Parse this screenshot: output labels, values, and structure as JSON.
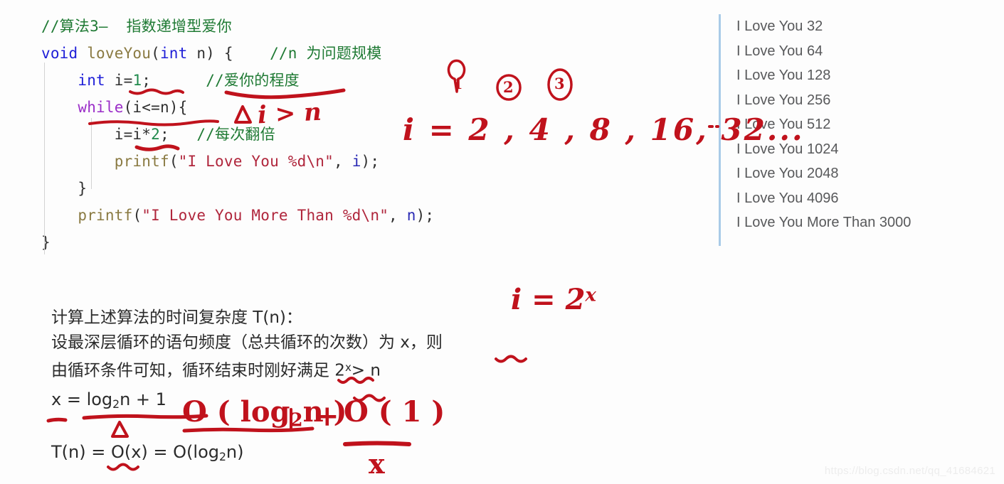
{
  "code": {
    "lines": [
      {
        "id": "comment-title",
        "tokens": [
          {
            "c": "cmt",
            "t": "//算法3—  指数递增型爱你"
          }
        ]
      },
      {
        "id": "func-signature",
        "tokens": [
          {
            "c": "kw",
            "t": "void"
          },
          {
            "c": "pl",
            "t": " "
          },
          {
            "c": "fn",
            "t": "loveYou"
          },
          {
            "c": "pl",
            "t": "("
          },
          {
            "c": "kw",
            "t": "int"
          },
          {
            "c": "pl",
            "t": " n) {"
          },
          {
            "c": "pl",
            "t": "    "
          },
          {
            "c": "cmt",
            "t": "//n 为问题规模"
          }
        ]
      },
      {
        "id": "decl-i",
        "tokens": [
          {
            "c": "pl",
            "t": "    "
          },
          {
            "c": "kw",
            "t": "int"
          },
          {
            "c": "pl",
            "t": " i="
          },
          {
            "c": "num",
            "t": "1"
          },
          {
            "c": "pl",
            "t": ";"
          },
          {
            "c": "pl",
            "t": "      "
          },
          {
            "c": "cmt",
            "t": "//爱你的程度"
          }
        ]
      },
      {
        "id": "while-head",
        "tokens": [
          {
            "c": "pl",
            "t": "    "
          },
          {
            "c": "kw2",
            "t": "while"
          },
          {
            "c": "pl",
            "t": "(i<=n){"
          }
        ]
      },
      {
        "id": "double-i",
        "tokens": [
          {
            "c": "pl",
            "t": "        i=i*"
          },
          {
            "c": "num",
            "t": "2"
          },
          {
            "c": "pl",
            "t": ";"
          },
          {
            "c": "pl",
            "t": "   "
          },
          {
            "c": "cmt",
            "t": "//每次翻倍"
          }
        ]
      },
      {
        "id": "printf-inner",
        "tokens": [
          {
            "c": "pl",
            "t": "        "
          },
          {
            "c": "fn",
            "t": "printf"
          },
          {
            "c": "pl",
            "t": "("
          },
          {
            "c": "str",
            "t": "\"I Love You %d\\n\""
          },
          {
            "c": "pl",
            "t": ", "
          },
          {
            "c": "var",
            "t": "i"
          },
          {
            "c": "pl",
            "t": ");"
          }
        ]
      },
      {
        "id": "close-while",
        "tokens": [
          {
            "c": "pl",
            "t": "    }"
          }
        ]
      },
      {
        "id": "printf-outer",
        "tokens": [
          {
            "c": "pl",
            "t": "    "
          },
          {
            "c": "fn",
            "t": "printf"
          },
          {
            "c": "pl",
            "t": "("
          },
          {
            "c": "str",
            "t": "\"I Love You More Than %d\\n\""
          },
          {
            "c": "pl",
            "t": ", "
          },
          {
            "c": "var",
            "t": "n"
          },
          {
            "c": "pl",
            "t": ");"
          }
        ]
      },
      {
        "id": "close-func",
        "tokens": [
          {
            "c": "pl",
            "t": "}"
          }
        ]
      }
    ]
  },
  "console": {
    "lines": [
      "I Love You 32",
      "I Love You 64",
      "I Love You 128",
      "I Love You 256",
      "I Love You 512",
      "I Love You 1024",
      "I Love You 2048",
      "I Love You 4096",
      "I Love You More Than 3000"
    ]
  },
  "prose": {
    "line1": "计算上述算法的时间复杂度 T(n)：",
    "line2": "设最深层循环的语句频度（总共循环的次数）为 x，则",
    "line3_a": "由循环条件可知，循环结束时刚好满足 2",
    "line3_sup": "x",
    "line3_b": "> n",
    "eq_x_a": "x = log",
    "eq_x_sub": "2",
    "eq_x_b": "n + 1",
    "eq_t_a": "T(n) = O(x) = O(log",
    "eq_t_sub": "2",
    "eq_t_b": "n)"
  },
  "annotations": {
    "marker1": "①",
    "marker2": "②",
    "marker3": "③",
    "i_sequence": "i = 2 , 4 , 8 , 16, 32...",
    "i_gt_n": "i > n",
    "triangle_code": "△",
    "i_eq_2x_base": "i = 2",
    "i_eq_2x_exp": "x",
    "big_o_log": "O ( log",
    "big_o_log_sub": "2",
    "big_o_log_end": "n )",
    "plus": "+",
    "big_o_one": "O ( 1 )",
    "denominator_x": "x",
    "triangle_delta": "△"
  },
  "watermark": "https://blog.csdn.net/qq_41684621",
  "colors": {
    "ink": "#c0121c",
    "keyword": "#2020d8",
    "keyword2": "#9b2ec8",
    "function": "#8a7a42",
    "string": "#b0263c",
    "number": "#1f8a4c",
    "comment": "#1f7a34",
    "console_text": "#58595b",
    "console_border": "#a9cbe8",
    "background": "#ffffff"
  }
}
